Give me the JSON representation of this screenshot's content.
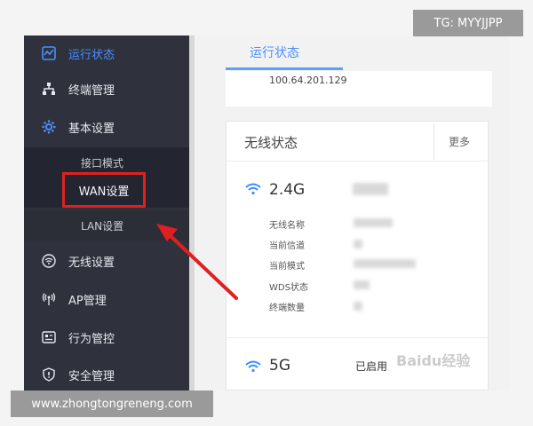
{
  "sidebar": {
    "items": [
      {
        "label": "运行状态",
        "icon": "status-chart-icon",
        "active": true
      },
      {
        "label": "终端管理",
        "icon": "network-tree-icon"
      },
      {
        "label": "基本设置",
        "icon": "gear-icon"
      },
      {
        "label": "无线设置",
        "icon": "wifi-circle-icon"
      },
      {
        "label": "AP管理",
        "icon": "antenna-icon"
      },
      {
        "label": "行为管控",
        "icon": "behavior-control-icon"
      },
      {
        "label": "安全管理",
        "icon": "shield-icon"
      }
    ],
    "subitems": [
      {
        "label": "接口模式"
      },
      {
        "label": "WAN设置",
        "highlighted": true
      },
      {
        "label": "LAN设置"
      }
    ]
  },
  "main": {
    "tab": "运行状态",
    "top_card": {
      "ip": "100.64.201.129"
    },
    "wireless": {
      "title": "无线状态",
      "more": "更多",
      "band_24": {
        "name": "2.4G",
        "rows": [
          "无线名称",
          "当前信道",
          "当前模式",
          "WDS状态",
          "终端数量"
        ]
      },
      "band_5": {
        "name": "5G",
        "status": "已启用"
      }
    }
  },
  "overlays": {
    "tg": "TG: MYYJJPP",
    "site": "www.zhongtongreneng.com",
    "baidu": "Baidu经验"
  },
  "colors": {
    "accent": "#4a90ff",
    "highlight": "#e02020",
    "sidebar_bg": "#2f323c"
  }
}
